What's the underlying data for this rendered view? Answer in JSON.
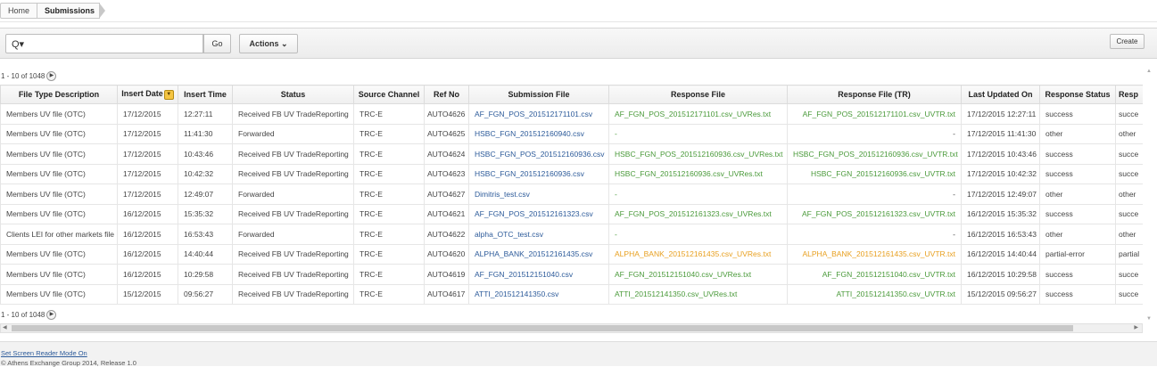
{
  "breadcrumb": {
    "home": "Home",
    "current": "Submissions"
  },
  "toolbar": {
    "search_placeholder": "",
    "search_icon": "Q▾",
    "go_label": "Go",
    "actions_label": "Actions ⌄",
    "create_label": "Create"
  },
  "pagination": {
    "text": "1 - 10 of 1048",
    "next_icon": "▶"
  },
  "columns": [
    "File Type Description",
    "Insert Date",
    "Insert Time",
    "Status",
    "Source Channel",
    "Ref No",
    "Submission File",
    "Response File",
    "Response File (TR)",
    "Last Updated On",
    "Response Status",
    "Resp"
  ],
  "rows": [
    [
      "Members UV file (OTC)",
      "17/12/2015",
      "12:27:11",
      "Received FB UV TradeReporting",
      "TRC-E",
      "AUTO4626",
      "AF_FGN_POS_201512171101.csv",
      "AF_FGN_POS_201512171101.csv_UVRes.txt",
      "AF_FGN_POS_201512171101.csv_UVTR.txt",
      "17/12/2015 12:27:11",
      "success",
      "succe"
    ],
    [
      "Members UV file (OTC)",
      "17/12/2015",
      "11:41:30",
      "Forwarded",
      "TRC-E",
      "AUTO4625",
      "HSBC_FGN_201512160940.csv",
      "-",
      "-",
      "17/12/2015 11:41:30",
      "other",
      "other"
    ],
    [
      "Members UV file (OTC)",
      "17/12/2015",
      "10:43:46",
      "Received FB UV TradeReporting",
      "TRC-E",
      "AUTO4624",
      "HSBC_FGN_POS_201512160936.csv",
      "HSBC_FGN_POS_201512160936.csv_UVRes.txt",
      "HSBC_FGN_POS_201512160936.csv_UVTR.txt",
      "17/12/2015 10:43:46",
      "success",
      "succe"
    ],
    [
      "Members UV file (OTC)",
      "17/12/2015",
      "10:42:32",
      "Received FB UV TradeReporting",
      "TRC-E",
      "AUTO4623",
      "HSBC_FGN_201512160936.csv",
      "HSBC_FGN_201512160936.csv_UVRes.txt",
      "HSBC_FGN_201512160936.csv_UVTR.txt",
      "17/12/2015 10:42:32",
      "success",
      "succe"
    ],
    [
      "Members UV file (OTC)",
      "17/12/2015",
      "12:49:07",
      "Forwarded",
      "TRC-E",
      "AUTO4627",
      "Dimitris_test.csv",
      "-",
      "-",
      "17/12/2015 12:49:07",
      "other",
      "other"
    ],
    [
      "Members UV file (OTC)",
      "16/12/2015",
      "15:35:32",
      "Received FB UV TradeReporting",
      "TRC-E",
      "AUTO4621",
      "AF_FGN_POS_201512161323.csv",
      "AF_FGN_POS_201512161323.csv_UVRes.txt",
      "AF_FGN_POS_201512161323.csv_UVTR.txt",
      "16/12/2015 15:35:32",
      "success",
      "succe"
    ],
    [
      "Clients LEI for other markets file",
      "16/12/2015",
      "16:53:43",
      "Forwarded",
      "TRC-E",
      "AUTO4622",
      "alpha_OTC_test.csv",
      "-",
      "-",
      "16/12/2015 16:53:43",
      "other",
      "other"
    ],
    [
      "Members UV file (OTC)",
      "16/12/2015",
      "14:40:44",
      "Received FB UV TradeReporting",
      "TRC-E",
      "AUTO4620",
      "ALPHA_BANK_201512161435.csv",
      "ALPHA_BANK_201512161435.csv_UVRes.txt",
      "ALPHA_BANK_201512161435.csv_UVTR.txt",
      "16/12/2015 14:40:44",
      "partial-error",
      "partial"
    ],
    [
      "Members UV file (OTC)",
      "16/12/2015",
      "10:29:58",
      "Received FB UV TradeReporting",
      "TRC-E",
      "AUTO4619",
      "AF_FGN_201512151040.csv",
      "AF_FGN_201512151040.csv_UVRes.txt",
      "AF_FGN_201512151040.csv_UVTR.txt",
      "16/12/2015 10:29:58",
      "success",
      "succe"
    ],
    [
      "Members UV file (OTC)",
      "15/12/2015",
      "09:56:27",
      "Received FB UV TradeReporting",
      "TRC-E",
      "AUTO4617",
      "ATTI_201512141350.csv",
      "ATTI_201512141350.csv_UVRes.txt",
      "ATTI_201512141350.csv_UVTR.txt",
      "15/12/2015 09:56:27",
      "success",
      "succe"
    ]
  ],
  "row_response_colors": [
    "green",
    "none",
    "green",
    "green",
    "none",
    "green",
    "none",
    "orange",
    "green",
    "green"
  ],
  "colors": {
    "link": "#2d5b9a",
    "response_ok": "#4a9a3a",
    "response_partial": "#e8a020"
  },
  "footer": {
    "screen_reader": "Set Screen Reader Mode On",
    "copyright": "© Athens Exchange Group 2014, Release 1.0"
  }
}
